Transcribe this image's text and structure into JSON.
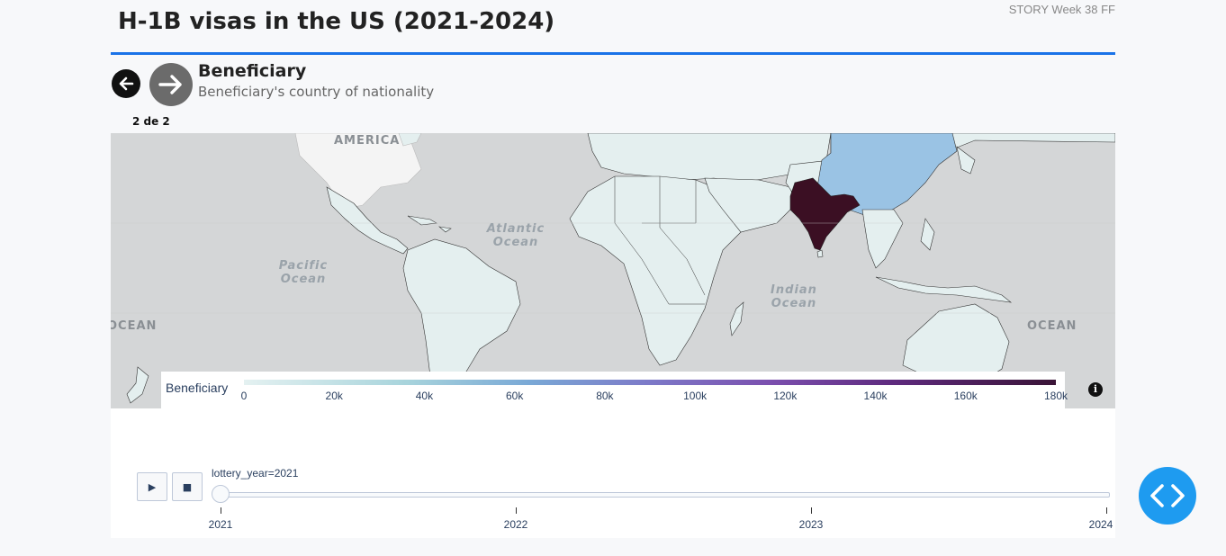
{
  "header": {
    "title": "H-1B visas in the US (2021-2024)",
    "tag": "STORY Week 38 FF"
  },
  "step": {
    "title": "Beneficiary",
    "subtitle": "Beneficiary's country of nationality",
    "counter": "2 de 2"
  },
  "map": {
    "labels": {
      "america": "AMERICA",
      "atlantic": "Atlantic Ocean",
      "pacific": "Pacific Ocean",
      "indian": "Indian Ocean",
      "ocean_left": "OCEAN",
      "ocean_right": "OCEAN"
    },
    "colors": {
      "india": "#3b0f23",
      "china": "#9ac3e4",
      "other_countries": "#e4efef",
      "water": "#d4d6d7",
      "land_no_data": "#f4f4f4"
    },
    "highlighted": [
      {
        "country": "India",
        "value_level": "max"
      },
      {
        "country": "China",
        "value_level": "mid"
      }
    ],
    "info_icon": "i"
  },
  "colorbar": {
    "title": "Beneficiary",
    "ticks": [
      "0",
      "20k",
      "40k",
      "60k",
      "80k",
      "100k",
      "120k",
      "140k",
      "160k",
      "180k"
    ]
  },
  "animation": {
    "play_icon": "▶",
    "stop_icon": "■",
    "slider_label": "lottery_year=2021",
    "years": [
      "2021",
      "2022",
      "2023",
      "2024"
    ],
    "current_year": "2021"
  },
  "icons": {
    "prev": "arrow-left-icon",
    "next": "arrow-right-icon",
    "code": "code-icon"
  }
}
